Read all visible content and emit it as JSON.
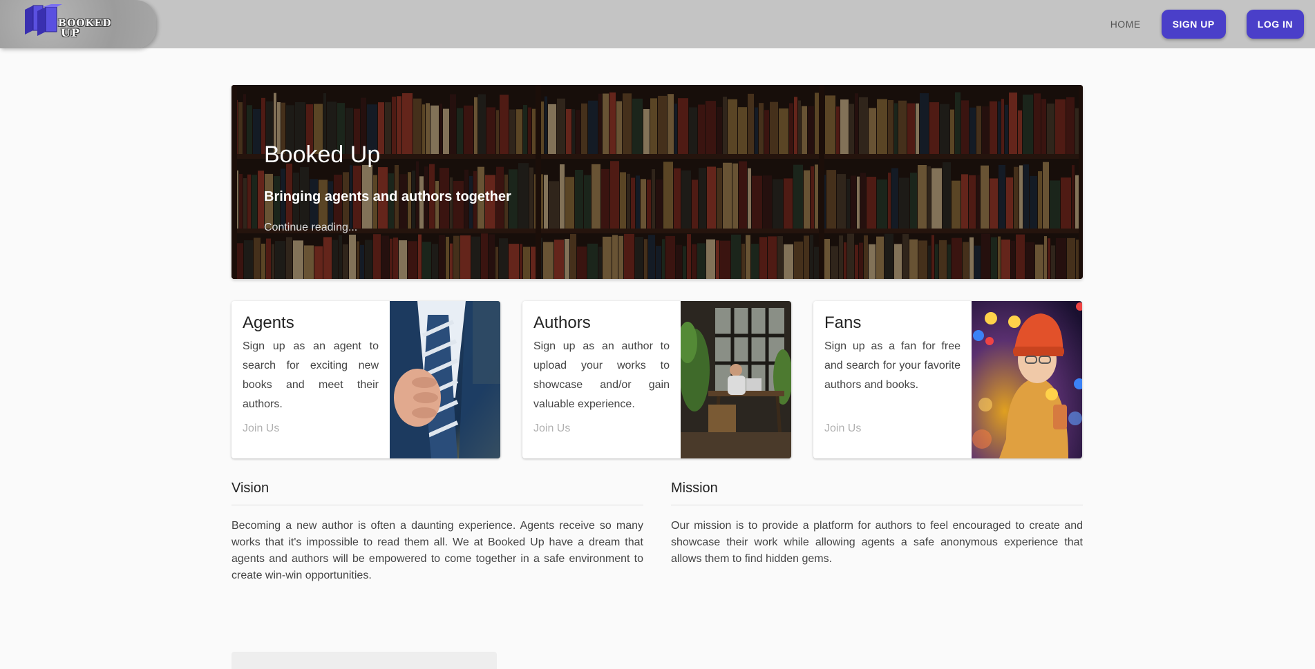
{
  "header": {
    "logo": {
      "line1": "BOOKED",
      "line2": "UP"
    },
    "nav": {
      "home": "HOME",
      "signup": "SIGN UP",
      "login": "LOG IN"
    }
  },
  "hero": {
    "title": "Booked Up",
    "subtitle": "Bringing agents and authors together",
    "link": "Continue reading..."
  },
  "cards": [
    {
      "title": "Agents",
      "text": "Sign up as an agent to search for exciting new books and meet their authors.",
      "link": "Join Us",
      "image": "businessman-tie"
    },
    {
      "title": "Authors",
      "text": "Sign up as an author to upload your works to showcase and/or gain valuable experience.",
      "link": "Join Us",
      "image": "writer-at-desk"
    },
    {
      "title": "Fans",
      "text": "Sign up as a fan for free and search for your favorite authors and books.",
      "link": "Join Us",
      "image": "woman-with-phone-emojis"
    }
  ],
  "vision": {
    "title": "Vision",
    "text": "Becoming a new author is often a daunting experience. Agents receive so many works that it's impossible to read them all. We at Booked Up have a dream that agents and authors will be empowered to come together in a safe environment to create win-win opportunities."
  },
  "mission": {
    "title": "Mission",
    "text": "Our mission is to provide a platform for authors to feel encouraged to create and showcase their work while allowing agents a safe anonymous experience that allows them to find hidden gems."
  },
  "colors": {
    "accent": "#4a3fc9",
    "appbar": "#c4c4c4",
    "background": "#fafafa"
  }
}
